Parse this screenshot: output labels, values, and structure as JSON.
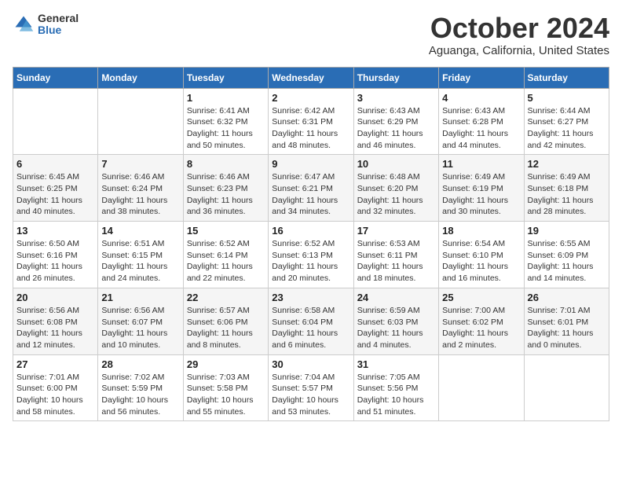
{
  "logo": {
    "general": "General",
    "blue": "Blue"
  },
  "title": "October 2024",
  "location": "Aguanga, California, United States",
  "days_of_week": [
    "Sunday",
    "Monday",
    "Tuesday",
    "Wednesday",
    "Thursday",
    "Friday",
    "Saturday"
  ],
  "weeks": [
    [
      {
        "day": "",
        "text": ""
      },
      {
        "day": "",
        "text": ""
      },
      {
        "day": "1",
        "text": "Sunrise: 6:41 AM\nSunset: 6:32 PM\nDaylight: 11 hours and 50 minutes."
      },
      {
        "day": "2",
        "text": "Sunrise: 6:42 AM\nSunset: 6:31 PM\nDaylight: 11 hours and 48 minutes."
      },
      {
        "day": "3",
        "text": "Sunrise: 6:43 AM\nSunset: 6:29 PM\nDaylight: 11 hours and 46 minutes."
      },
      {
        "day": "4",
        "text": "Sunrise: 6:43 AM\nSunset: 6:28 PM\nDaylight: 11 hours and 44 minutes."
      },
      {
        "day": "5",
        "text": "Sunrise: 6:44 AM\nSunset: 6:27 PM\nDaylight: 11 hours and 42 minutes."
      }
    ],
    [
      {
        "day": "6",
        "text": "Sunrise: 6:45 AM\nSunset: 6:25 PM\nDaylight: 11 hours and 40 minutes."
      },
      {
        "day": "7",
        "text": "Sunrise: 6:46 AM\nSunset: 6:24 PM\nDaylight: 11 hours and 38 minutes."
      },
      {
        "day": "8",
        "text": "Sunrise: 6:46 AM\nSunset: 6:23 PM\nDaylight: 11 hours and 36 minutes."
      },
      {
        "day": "9",
        "text": "Sunrise: 6:47 AM\nSunset: 6:21 PM\nDaylight: 11 hours and 34 minutes."
      },
      {
        "day": "10",
        "text": "Sunrise: 6:48 AM\nSunset: 6:20 PM\nDaylight: 11 hours and 32 minutes."
      },
      {
        "day": "11",
        "text": "Sunrise: 6:49 AM\nSunset: 6:19 PM\nDaylight: 11 hours and 30 minutes."
      },
      {
        "day": "12",
        "text": "Sunrise: 6:49 AM\nSunset: 6:18 PM\nDaylight: 11 hours and 28 minutes."
      }
    ],
    [
      {
        "day": "13",
        "text": "Sunrise: 6:50 AM\nSunset: 6:16 PM\nDaylight: 11 hours and 26 minutes."
      },
      {
        "day": "14",
        "text": "Sunrise: 6:51 AM\nSunset: 6:15 PM\nDaylight: 11 hours and 24 minutes."
      },
      {
        "day": "15",
        "text": "Sunrise: 6:52 AM\nSunset: 6:14 PM\nDaylight: 11 hours and 22 minutes."
      },
      {
        "day": "16",
        "text": "Sunrise: 6:52 AM\nSunset: 6:13 PM\nDaylight: 11 hours and 20 minutes."
      },
      {
        "day": "17",
        "text": "Sunrise: 6:53 AM\nSunset: 6:11 PM\nDaylight: 11 hours and 18 minutes."
      },
      {
        "day": "18",
        "text": "Sunrise: 6:54 AM\nSunset: 6:10 PM\nDaylight: 11 hours and 16 minutes."
      },
      {
        "day": "19",
        "text": "Sunrise: 6:55 AM\nSunset: 6:09 PM\nDaylight: 11 hours and 14 minutes."
      }
    ],
    [
      {
        "day": "20",
        "text": "Sunrise: 6:56 AM\nSunset: 6:08 PM\nDaylight: 11 hours and 12 minutes."
      },
      {
        "day": "21",
        "text": "Sunrise: 6:56 AM\nSunset: 6:07 PM\nDaylight: 11 hours and 10 minutes."
      },
      {
        "day": "22",
        "text": "Sunrise: 6:57 AM\nSunset: 6:06 PM\nDaylight: 11 hours and 8 minutes."
      },
      {
        "day": "23",
        "text": "Sunrise: 6:58 AM\nSunset: 6:04 PM\nDaylight: 11 hours and 6 minutes."
      },
      {
        "day": "24",
        "text": "Sunrise: 6:59 AM\nSunset: 6:03 PM\nDaylight: 11 hours and 4 minutes."
      },
      {
        "day": "25",
        "text": "Sunrise: 7:00 AM\nSunset: 6:02 PM\nDaylight: 11 hours and 2 minutes."
      },
      {
        "day": "26",
        "text": "Sunrise: 7:01 AM\nSunset: 6:01 PM\nDaylight: 11 hours and 0 minutes."
      }
    ],
    [
      {
        "day": "27",
        "text": "Sunrise: 7:01 AM\nSunset: 6:00 PM\nDaylight: 10 hours and 58 minutes."
      },
      {
        "day": "28",
        "text": "Sunrise: 7:02 AM\nSunset: 5:59 PM\nDaylight: 10 hours and 56 minutes."
      },
      {
        "day": "29",
        "text": "Sunrise: 7:03 AM\nSunset: 5:58 PM\nDaylight: 10 hours and 55 minutes."
      },
      {
        "day": "30",
        "text": "Sunrise: 7:04 AM\nSunset: 5:57 PM\nDaylight: 10 hours and 53 minutes."
      },
      {
        "day": "31",
        "text": "Sunrise: 7:05 AM\nSunset: 5:56 PM\nDaylight: 10 hours and 51 minutes."
      },
      {
        "day": "",
        "text": ""
      },
      {
        "day": "",
        "text": ""
      }
    ]
  ]
}
